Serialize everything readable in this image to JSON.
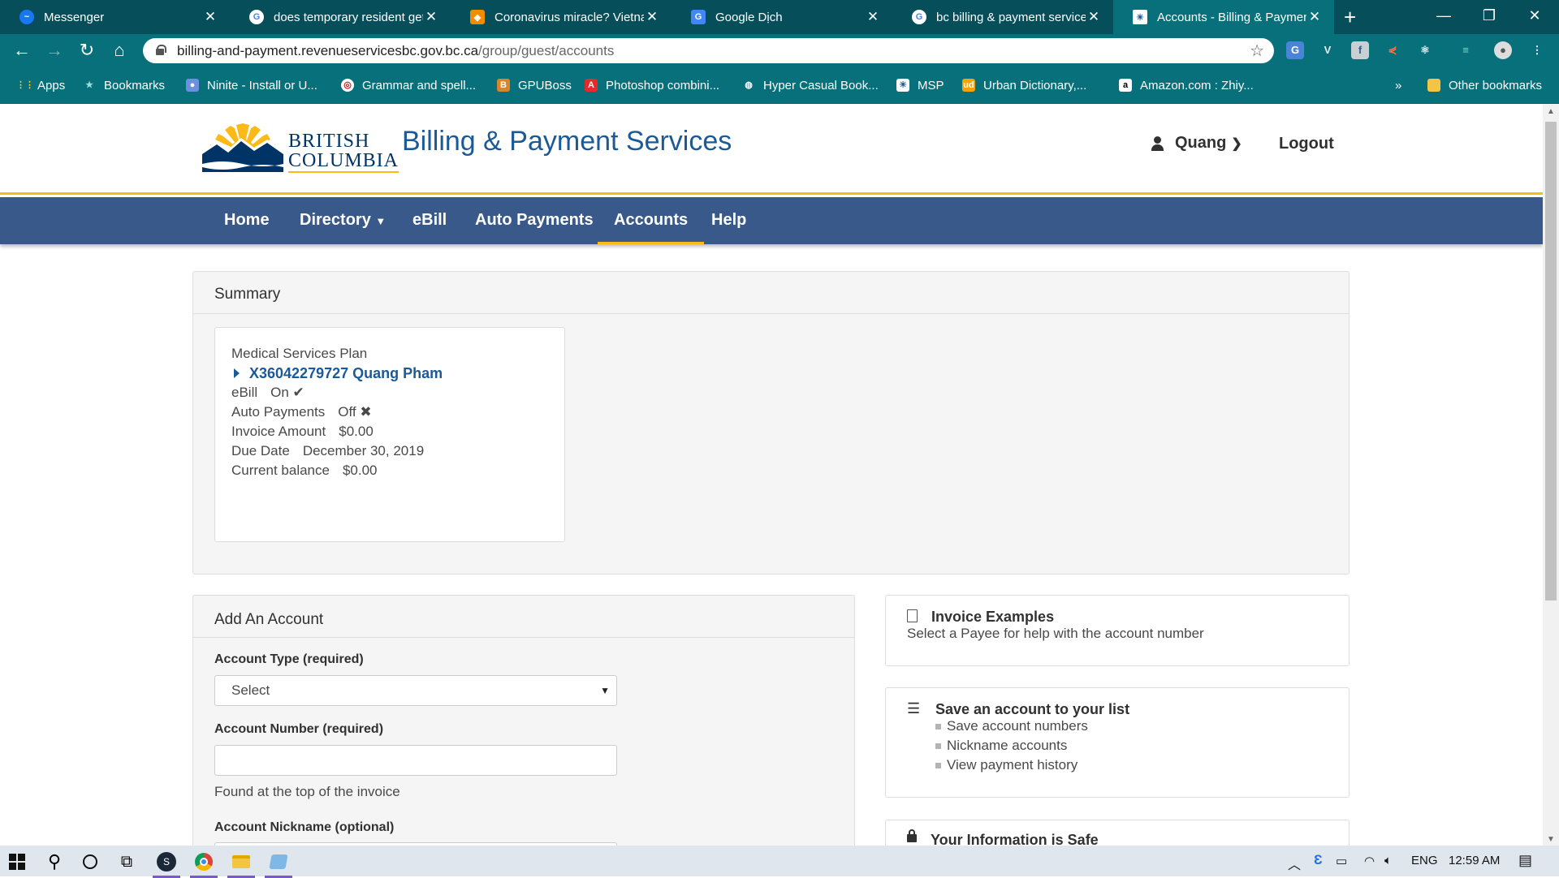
{
  "browser": {
    "tabs": [
      {
        "title": "Messenger",
        "icon": "messenger-icon",
        "color": "#1877f2"
      },
      {
        "title": "does temporary resident get",
        "icon": "google-icon",
        "color": "#ffffff"
      },
      {
        "title": "Coronavirus miracle? Vietnam",
        "icon": "news-icon",
        "color": "#f08c00"
      },
      {
        "title": "Google Dịch",
        "icon": "google-translate-icon",
        "color": "#4285f4"
      },
      {
        "title": "bc billing & payment services",
        "icon": "google-icon",
        "color": "#ffffff"
      },
      {
        "title": "Accounts - Billing & Payment",
        "icon": "bc-icon",
        "color": "#1b5a96"
      }
    ],
    "new_tab": "+",
    "url_host": "billing-and-payment.revenueservicesbc.gov.bc.ca",
    "url_path": "/group/guest/accounts",
    "bookmarks": [
      {
        "label": "Apps",
        "icon": "apps-grid-icon"
      },
      {
        "label": "Bookmarks",
        "icon": "star-icon"
      },
      {
        "label": "Ninite - Install or U...",
        "icon": "ninite-icon"
      },
      {
        "label": "Grammar and spell...",
        "icon": "grammar-icon"
      },
      {
        "label": "GPUBoss",
        "icon": "gpuboss-icon"
      },
      {
        "label": "Photoshop combini...",
        "icon": "adobe-icon"
      },
      {
        "label": "Hyper Casual Book...",
        "icon": "globe-icon"
      },
      {
        "label": "MSP",
        "icon": "bc-icon"
      },
      {
        "label": "Urban Dictionary,...",
        "icon": "urban-dictionary-icon"
      },
      {
        "label": "Amazon.com : Zhiy...",
        "icon": "amazon-icon"
      }
    ],
    "bookmarks_overflow": "»",
    "other_bookmarks": "Other bookmarks"
  },
  "site": {
    "logo_line1": "BRITISH",
    "logo_line2": "COLUMBIA",
    "brand": "Billing & Payment Services",
    "user": "Quang",
    "logout": "Logout",
    "nav": [
      "Home",
      "Directory",
      "eBill",
      "Auto Payments",
      "Accounts",
      "Help"
    ]
  },
  "summary": {
    "title": "Summary",
    "plan": "Medical Services Plan",
    "account_link": "X36042279727 Quang Pham",
    "ebill_label": "eBill",
    "ebill_value": "On ✔",
    "auto_label": "Auto Payments",
    "auto_value": "Off ✖",
    "invoice_label": "Invoice Amount",
    "invoice_value": "$0.00",
    "due_label": "Due Date",
    "due_value": "December 30, 2019",
    "balance_label": "Current balance",
    "balance_value": "$0.00"
  },
  "add_account": {
    "title": "Add An Account",
    "type_label": "Account Type (required)",
    "type_value": "Select",
    "number_label": "Account Number (required)",
    "number_value": "",
    "number_help": "Found at the top of the invoice",
    "nickname_label": "Account Nickname (optional)"
  },
  "info": {
    "invoice_title": "Invoice Examples",
    "invoice_text": "Select a Payee for help with the account number",
    "save_title": "Save an account to your list",
    "save_items": [
      "Save account numbers",
      "Nickname accounts",
      "View payment history"
    ],
    "safe_title": "Your Information is Safe"
  },
  "taskbar": {
    "language": "ENG",
    "time": "12:59 AM"
  }
}
